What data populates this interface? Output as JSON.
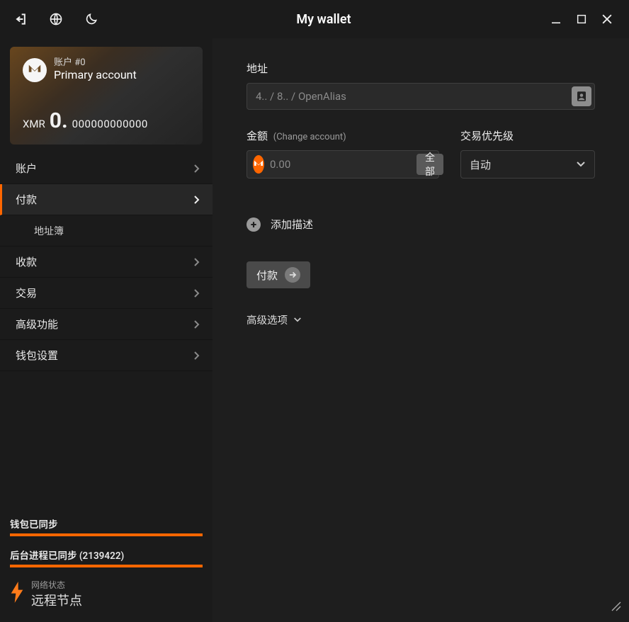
{
  "window": {
    "title": "My wallet"
  },
  "colors": {
    "accent": "#ff6600"
  },
  "account": {
    "number_label": "账户 #0",
    "name": "Primary account",
    "currency": "XMR",
    "balance_int": "0.",
    "balance_dec": "000000000000"
  },
  "sidebar": {
    "items": {
      "accounts": "账户",
      "send": "付款",
      "address_book": "地址簿",
      "receive": "收款",
      "transactions": "交易",
      "advanced": "高级功能",
      "settings": "钱包设置"
    }
  },
  "status": {
    "wallet_sync": "钱包已同步",
    "daemon_sync": "后台进程已同步 (2139422)",
    "net_label": "网络状态",
    "net_value": "远程节点"
  },
  "send": {
    "address_label": "地址",
    "address_placeholder": "4.. / 8.. / OpenAlias",
    "amount_label": "金额",
    "amount_hint": "(Change account)",
    "amount_placeholder": "0.00",
    "all_button": "全部",
    "priority_label": "交易优先级",
    "priority_value": "自动",
    "add_desc": "添加描述",
    "pay_button": "付款",
    "advanced": "高级选项"
  }
}
